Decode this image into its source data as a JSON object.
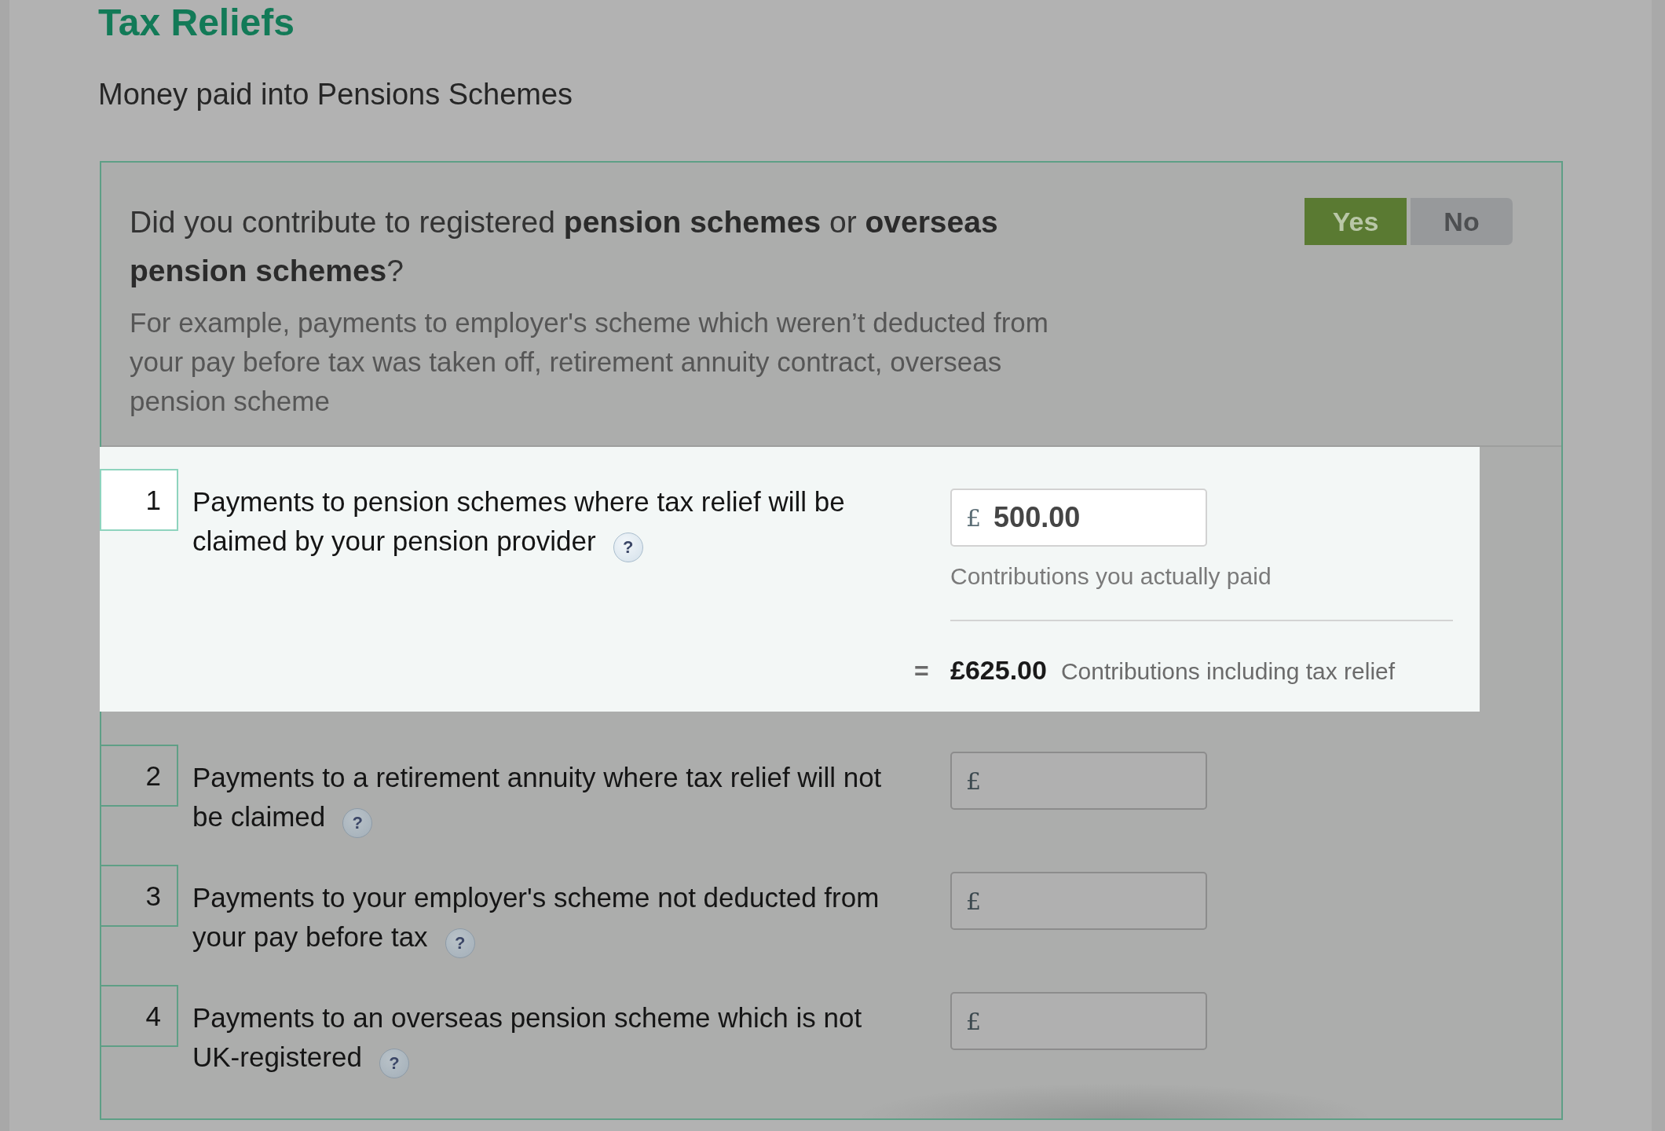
{
  "page": {
    "title": "Tax Reliefs",
    "subtitle": "Money paid into Pensions Schemes"
  },
  "question": {
    "text": "Did you contribute to registered **pension schemes** or **overseas pension schemes**?",
    "hint": "For example, payments to employer's scheme which weren’t deducted from your pay before tax was taken off, retirement annuity contract, overseas pension scheme",
    "options": [
      {
        "label": "Yes",
        "selected": true
      },
      {
        "label": "No",
        "selected": false
      }
    ]
  },
  "items": [
    {
      "number": "1",
      "label": "Payments to pension schemes where tax relief will be claimed by your pension provider",
      "help": "?",
      "highlighted": true,
      "currency": "£",
      "value": "500.00",
      "caption": "Contributions you actually paid",
      "total": {
        "equals": "=",
        "amount": "£625.00",
        "caption": "Contributions including tax relief"
      }
    },
    {
      "number": "2",
      "label": "Payments to a retirement annuity where tax relief will not be claimed",
      "help": "?",
      "highlighted": false,
      "currency": "£"
    },
    {
      "number": "3",
      "label": "Payments to your employer's scheme not deducted from your pay before tax",
      "help": "?",
      "highlighted": false,
      "currency": "£"
    },
    {
      "number": "4",
      "label": "Payments to an overseas pension scheme which is not UK-registered",
      "help": "?",
      "highlighted": false,
      "currency": "£"
    }
  ]
}
